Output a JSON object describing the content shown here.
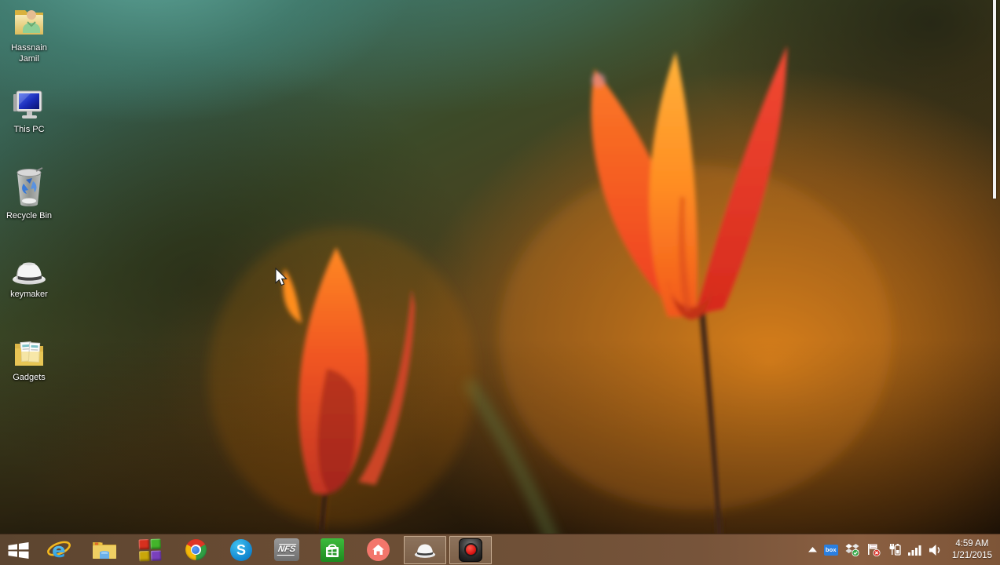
{
  "desktop": {
    "icons": [
      {
        "id": "user-folder",
        "label": "Hassnain Jamil"
      },
      {
        "id": "this-pc",
        "label": "This PC"
      },
      {
        "id": "recycle-bin",
        "label": "Recycle Bin"
      },
      {
        "id": "keymaker",
        "label": "keymaker"
      },
      {
        "id": "gadgets",
        "label": "Gadgets"
      }
    ]
  },
  "taskbar": {
    "buttons": [
      {
        "name": "start"
      },
      {
        "name": "internet-explorer",
        "letter": "e"
      },
      {
        "name": "file-explorer"
      },
      {
        "name": "windows-activator"
      },
      {
        "name": "chrome"
      },
      {
        "name": "skype",
        "letter": "S"
      },
      {
        "name": "need-for-speed",
        "label": "NFS"
      },
      {
        "name": "windows-store"
      },
      {
        "name": "home-app"
      },
      {
        "name": "keymaker",
        "active": true
      },
      {
        "name": "screen-recorder",
        "active": true
      }
    ]
  },
  "tray": {
    "box_label": "box",
    "time": "4:59 AM",
    "date": "1/21/2015"
  },
  "colors": {
    "taskbar": "#6f5037",
    "accent_orange": "#db8018",
    "teal_top": "#60a89c",
    "tulip_red": "#ee3a26",
    "tulip_orange": "#ff9a28"
  }
}
